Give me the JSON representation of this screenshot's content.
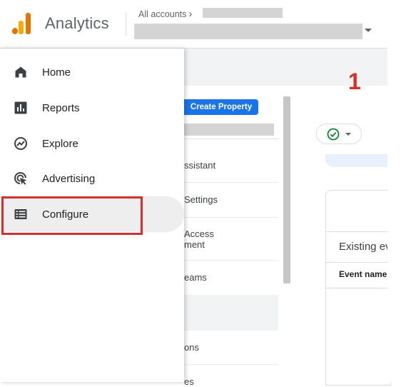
{
  "app": {
    "title": "Analytics",
    "logo": "google-analytics-logo",
    "brand_colors": {
      "orange": "#F9AB00",
      "dark_orange": "#E37400"
    }
  },
  "header": {
    "breadcrumb": "All accounts",
    "breadcrumb_chevron": "›"
  },
  "annotation": {
    "step_number": "1",
    "color": "#D93025",
    "highlight_color": "#D32F2F"
  },
  "admin_menu": {
    "create_property_label": "Create Property",
    "items": [
      {
        "label": "ssistant"
      },
      {
        "label": "Settings"
      },
      {
        "label": "Access\nment"
      },
      {
        "label": "eams"
      },
      {
        "label": "ons"
      },
      {
        "label": "es"
      }
    ]
  },
  "main": {
    "status_icon": "check-circle-icon",
    "card_title": "Existing ev",
    "column_header": "Event name"
  },
  "nav": {
    "items": [
      {
        "label": "Home",
        "icon": "home-icon"
      },
      {
        "label": "Reports",
        "icon": "reports-icon"
      },
      {
        "label": "Explore",
        "icon": "explore-icon"
      },
      {
        "label": "Advertising",
        "icon": "advertising-icon"
      },
      {
        "label": "Configure",
        "icon": "configure-icon",
        "selected": true
      }
    ]
  }
}
